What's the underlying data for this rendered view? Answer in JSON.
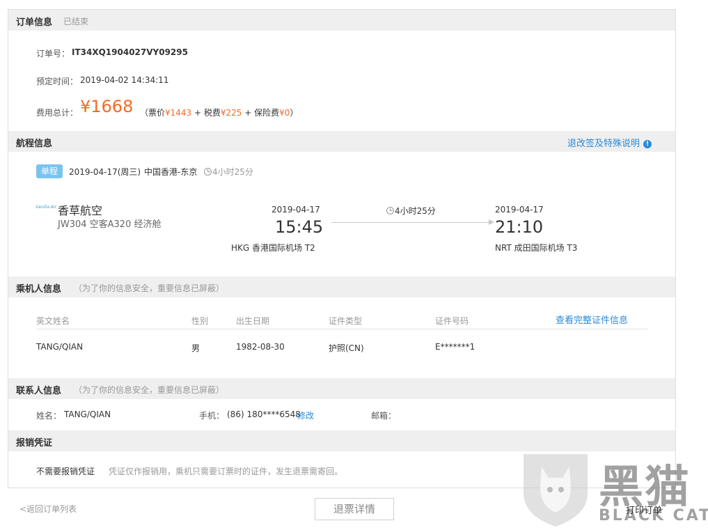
{
  "order": {
    "section_title": "订单信息",
    "status": "已结束",
    "number_label": "订单号：",
    "number": "IT34XQ1904027VY09295",
    "booking_time_label": "预定时间：",
    "booking_time": "2019-04-02 14:34:11",
    "total_label": "费用总计：",
    "total": "¥1668",
    "breakdown_open": "（票价",
    "fare": "¥1443",
    "tax_label": "+ 税费",
    "tax": "¥225",
    "insurance_label": "+ 保险费",
    "insurance": "¥0",
    "breakdown_close": "）"
  },
  "itinerary": {
    "section_title": "航程信息",
    "policy_link": "退改签及特殊说明",
    "trip_type": "单程",
    "date": "2019-04-17(周三)",
    "route": "中国香港-东京",
    "duration": "4小时25分",
    "airline": "香草航空",
    "airline_logo_text": "Vanilla Air",
    "flight_info": "JW304  空客A320  经济舱",
    "depart_date": "2019-04-17",
    "depart_time": "15:45",
    "depart_airport": "HKG  香港国际机场  T2",
    "flight_duration": "4小时25分",
    "arrive_date": "2019-04-17",
    "arrive_time": "21:10",
    "arrive_airport": "NRT  成田国际机场  T3"
  },
  "passengers": {
    "section_title": "乘机人信息",
    "note": "（为了你的信息安全，重要信息已屏蔽）",
    "view_full_link": "查看完整证件信息",
    "columns": [
      "英文姓名",
      "性别",
      "出生日期",
      "证件类型",
      "证件号码"
    ],
    "rows": [
      [
        "TANG/QIAN",
        "男",
        "1982-08-30",
        "护照(CN)",
        "E*******1"
      ]
    ]
  },
  "contact": {
    "section_title": "联系人信息",
    "note": "（为了你的信息安全，重要信息已屏蔽）",
    "name_label": "姓名：",
    "name": "TANG/QIAN",
    "phone_label": "手机：",
    "phone": "(86) 180****6548",
    "edit_link": "修改",
    "email_label": "邮箱："
  },
  "receipt": {
    "section_title": "报销凭证",
    "value": "不需要报销凭证",
    "hint": "凭证仅作报销用，乘机只需要订票时的证件，发生退票需寄回。"
  },
  "footer": {
    "back_link": "<返回订单列表",
    "refund_button": "退票详情",
    "print_link": "打印订单"
  },
  "watermark": {
    "text_cn": "黑猫",
    "text_en": "BLACK CAT"
  },
  "colors": {
    "accent_orange": "#f26b26",
    "link_blue": "#2a8bd8",
    "badge_blue": "#7ac3ef",
    "section_gray": "#efefef"
  }
}
